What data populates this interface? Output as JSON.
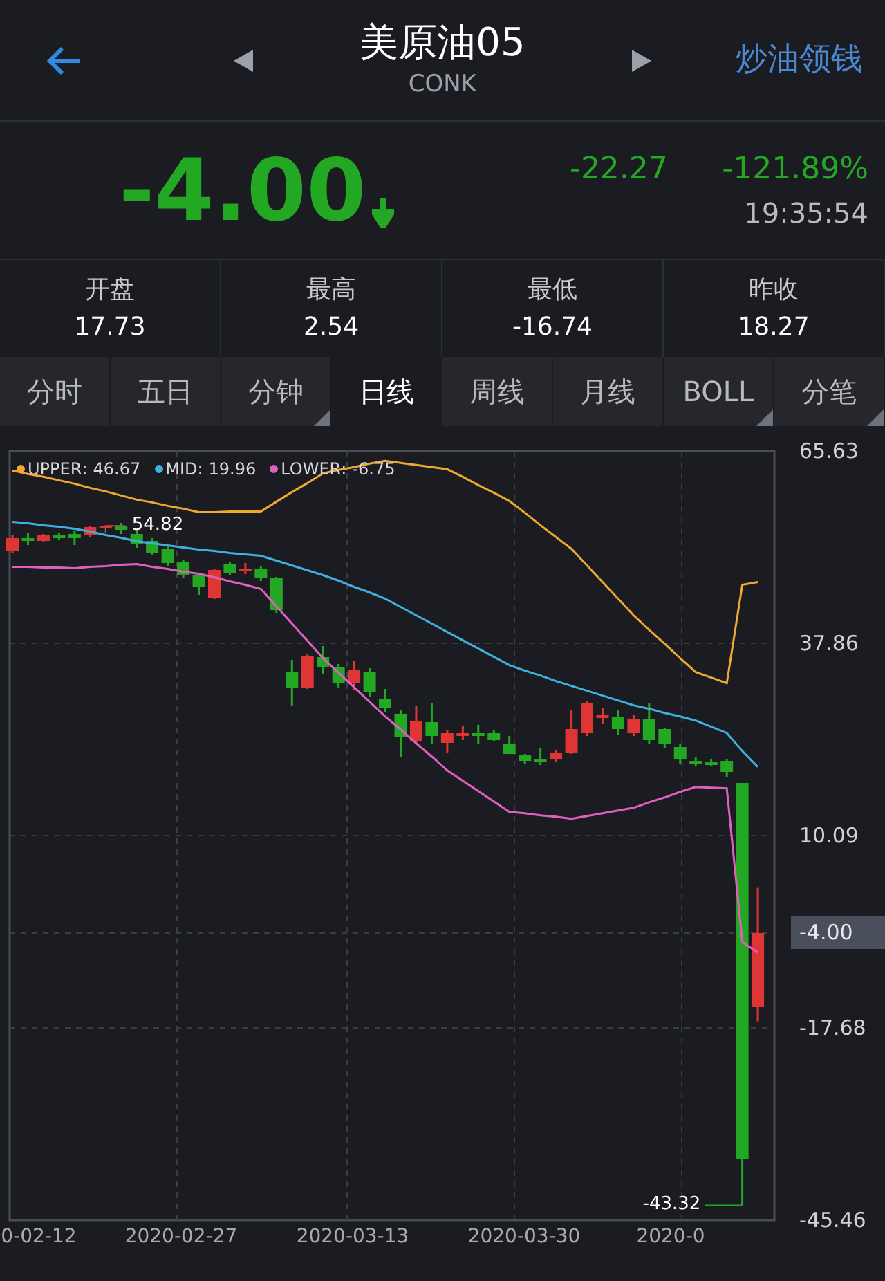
{
  "header": {
    "title": "美原油05",
    "subtitle": "CONK",
    "action": "炒油领钱"
  },
  "quote": {
    "price": "-4.00",
    "change": "-22.27",
    "change_pct": "-121.89%",
    "time": "19:35:54"
  },
  "stats": [
    {
      "label": "开盘",
      "value": "17.73"
    },
    {
      "label": "最高",
      "value": "2.54"
    },
    {
      "label": "最低",
      "value": "-16.74"
    },
    {
      "label": "昨收",
      "value": "18.27"
    }
  ],
  "tabs": [
    {
      "label": "分时",
      "selected": false,
      "dropdown": false
    },
    {
      "label": "五日",
      "selected": false,
      "dropdown": false
    },
    {
      "label": "分钟",
      "selected": false,
      "dropdown": true
    },
    {
      "label": "日线",
      "selected": true,
      "dropdown": false
    },
    {
      "label": "周线",
      "selected": false,
      "dropdown": false
    },
    {
      "label": "月线",
      "selected": false,
      "dropdown": false
    },
    {
      "label": "BOLL",
      "selected": false,
      "dropdown": true
    },
    {
      "label": "分笔",
      "selected": false,
      "dropdown": true
    }
  ],
  "chart": {
    "legend_separator": ":",
    "legend": [
      {
        "value": "46.67"
      },
      {
        "value": "19.96"
      },
      {
        "value": "-6.75"
      }
    ],
    "x_labels": [
      "0-02-12",
      "2020-02-27",
      "2020-03-13",
      "2020-03-30",
      "2020-0"
    ],
    "price_tag": "-4.00",
    "chart_data": {
      "type": "candlestick",
      "grid": true,
      "legend": "top-left",
      "ohlc": [
        [
          51.24,
          53.44,
          50.85,
          53.04
        ],
        [
          53.04,
          53.84,
          52.04,
          52.64
        ],
        [
          52.64,
          53.64,
          52.44,
          53.44
        ],
        [
          53.44,
          53.84,
          52.84,
          53.04
        ],
        [
          53.64,
          54.04,
          52.04,
          53.04
        ],
        [
          53.44,
          54.84,
          53.24,
          54.64
        ],
        [
          54.64,
          54.82,
          54.44,
          54.82
        ],
        [
          54.84,
          55.24,
          53.64,
          54.24
        ],
        [
          53.64,
          54.04,
          51.65,
          52.24
        ],
        [
          52.64,
          53.04,
          50.65,
          50.85
        ],
        [
          51.45,
          51.85,
          49.05,
          49.45
        ],
        [
          49.65,
          49.85,
          47.25,
          47.65
        ],
        [
          47.65,
          48.05,
          44.85,
          46.05
        ],
        [
          44.45,
          48.65,
          44.25,
          48.45
        ],
        [
          49.25,
          49.65,
          47.65,
          48.05
        ],
        [
          48.25,
          49.45,
          47.85,
          48.65
        ],
        [
          48.65,
          49.05,
          46.85,
          47.25
        ],
        [
          47.25,
          47.45,
          42.26,
          42.65
        ],
        [
          33.66,
          35.46,
          28.87,
          31.46
        ],
        [
          31.46,
          36.26,
          31.26,
          36.06
        ],
        [
          35.86,
          37.46,
          33.46,
          34.46
        ],
        [
          34.46,
          34.86,
          31.46,
          32.06
        ],
        [
          32.06,
          35.26,
          31.06,
          34.06
        ],
        [
          33.66,
          34.26,
          30.07,
          30.86
        ],
        [
          29.87,
          31.26,
          27.87,
          28.47
        ],
        [
          27.67,
          28.27,
          21.47,
          24.27
        ],
        [
          23.67,
          28.87,
          23.27,
          26.67
        ],
        [
          26.47,
          29.27,
          23.27,
          24.47
        ],
        [
          23.47,
          25.27,
          22.07,
          24.87
        ],
        [
          24.47,
          25.87,
          23.87,
          24.87
        ],
        [
          24.87,
          26.07,
          23.27,
          24.47
        ],
        [
          24.87,
          25.27,
          23.67,
          23.87
        ],
        [
          23.27,
          24.47,
          21.87,
          21.87
        ],
        [
          21.67,
          21.87,
          20.47,
          20.87
        ],
        [
          21.07,
          22.67,
          20.27,
          20.67
        ],
        [
          21.07,
          22.47,
          20.67,
          22.07
        ],
        [
          22.07,
          28.27,
          21.87,
          25.47
        ],
        [
          24.87,
          29.47,
          24.47,
          29.27
        ],
        [
          27.07,
          28.47,
          26.27,
          27.47
        ],
        [
          27.27,
          28.27,
          24.67,
          25.47
        ],
        [
          24.87,
          27.47,
          24.47,
          26.87
        ],
        [
          26.87,
          29.27,
          23.27,
          23.87
        ],
        [
          25.47,
          25.67,
          22.67,
          23.27
        ],
        [
          22.87,
          23.27,
          20.47,
          21.07
        ],
        [
          20.87,
          21.47,
          20.07,
          20.47
        ],
        [
          20.67,
          21.07,
          20.07,
          20.27
        ],
        [
          20.87,
          21.07,
          18.47,
          19.27
        ],
        [
          17.68,
          17.68,
          -43.32,
          -36.66
        ],
        [
          -14.69,
          2.54,
          -16.74,
          -4.0
        ]
      ],
      "series": [
        {
          "name": "UPPER",
          "type": "line",
          "color": "#f0a830",
          "values": [
            62.8,
            62.3,
            61.9,
            61.4,
            60.9,
            60.3,
            59.8,
            59.2,
            58.6,
            58.2,
            57.7,
            57.3,
            56.8,
            56.8,
            56.9,
            56.9,
            56.9,
            58.3,
            59.7,
            61.0,
            62.4,
            62.9,
            63.3,
            63.8,
            64.2,
            63.9,
            63.6,
            63.3,
            63.0,
            61.9,
            60.7,
            59.6,
            58.4,
            56.7,
            54.9,
            53.2,
            51.5,
            49.1,
            46.7,
            44.3,
            41.9,
            39.8,
            37.8,
            35.7,
            33.7,
            32.9,
            32.1,
            46.3,
            46.7
          ]
        },
        {
          "name": "MID",
          "type": "line",
          "color": "#3fb0e0",
          "values": [
            55.4,
            55.2,
            54.9,
            54.7,
            54.4,
            54.0,
            53.5,
            53.1,
            52.6,
            52.3,
            52.0,
            51.7,
            51.4,
            51.2,
            50.9,
            50.7,
            50.5,
            49.8,
            49.1,
            48.4,
            47.7,
            46.9,
            46.0,
            45.2,
            44.3,
            43.1,
            41.9,
            40.7,
            39.5,
            38.3,
            37.1,
            35.9,
            34.7,
            33.9,
            33.2,
            32.4,
            31.7,
            31.0,
            30.3,
            29.6,
            28.9,
            28.4,
            27.8,
            27.3,
            26.7,
            25.8,
            24.9,
            22.3,
            20.0
          ]
        },
        {
          "name": "LOWER",
          "type": "line",
          "color": "#e060c0",
          "values": [
            48.9,
            48.9,
            48.8,
            48.8,
            48.7,
            48.9,
            49.0,
            49.2,
            49.3,
            48.9,
            48.6,
            48.2,
            47.9,
            47.4,
            46.8,
            46.3,
            45.7,
            43.2,
            40.7,
            38.2,
            35.7,
            33.6,
            31.5,
            29.4,
            27.3,
            25.4,
            23.4,
            21.5,
            19.5,
            18.0,
            16.5,
            15.0,
            13.5,
            13.3,
            13.0,
            12.8,
            12.5,
            12.9,
            13.3,
            13.7,
            14.1,
            14.9,
            15.6,
            16.4,
            17.1,
            17.0,
            16.9,
            -5.3,
            -6.8
          ]
        }
      ],
      "ylim": [
        -45.46,
        65.63
      ],
      "yticks": [
        {
          "value": 65.63,
          "label": "65.63"
        },
        {
          "value": 37.86,
          "label": "37.86"
        },
        {
          "value": 10.09,
          "label": "10.09"
        },
        {
          "value": -17.68,
          "label": "-17.68"
        },
        {
          "value": -45.46,
          "label": "-45.46"
        }
      ],
      "annotations": [
        "54.82",
        "-43.32"
      ]
    }
  }
}
